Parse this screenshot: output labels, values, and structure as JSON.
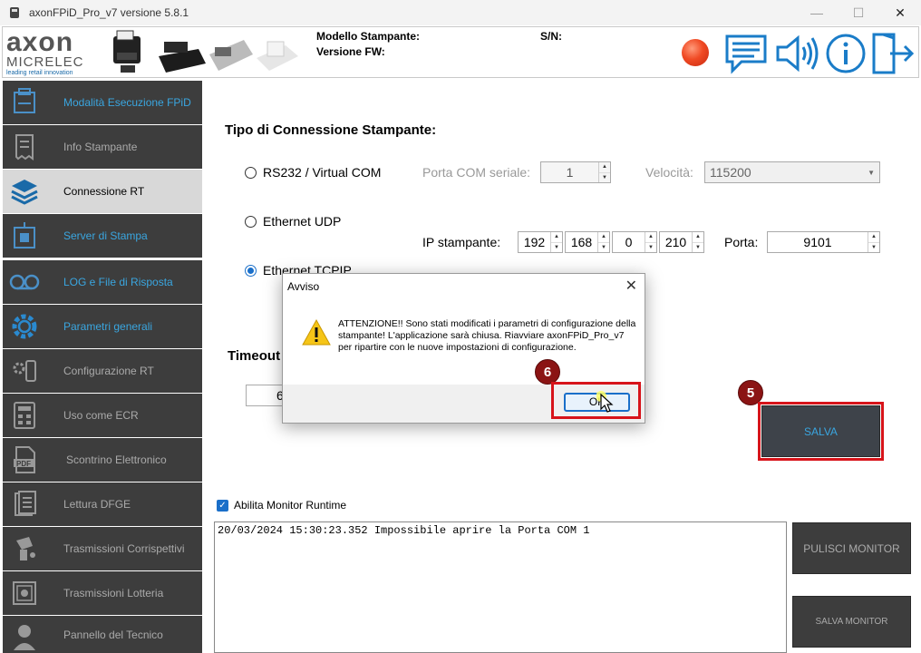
{
  "window": {
    "title": "axonFPiD_Pro_v7 versione 5.8.1",
    "min": "—",
    "max": "☐",
    "close": "✕"
  },
  "header": {
    "logo_main": "axon",
    "logo_sub": "MICRELEC",
    "logo_tag": "leading retail innovation",
    "model_label": "Modello Stampante:",
    "fw_label": "Versione FW:",
    "sn_label": "S/N:",
    "status_color": "#e8401c"
  },
  "sidebar": {
    "items": [
      {
        "label": "Modalità Esecuzione FPiD",
        "icon": "printer-server-icon",
        "highlight": true
      },
      {
        "label": "Info Stampante",
        "icon": "receipt-icon",
        "highlight": false
      },
      {
        "label": "Connessione RT",
        "icon": "layers-icon",
        "active": true
      },
      {
        "label": "Server di Stampa",
        "icon": "print-server-icon",
        "highlight": true
      },
      {
        "label": "LOG e File di Risposta",
        "icon": "tape-icon",
        "highlight": true
      },
      {
        "label": "Parametri generali",
        "icon": "gear-icon",
        "highlight": true
      },
      {
        "label": "Configurazione RT",
        "icon": "gear-device-icon",
        "highlight": false
      },
      {
        "label": "Uso come ECR",
        "icon": "calculator-icon",
        "highlight": false
      },
      {
        "label": "Scontrino Elettronico",
        "icon": "pdf-icon",
        "highlight": false
      },
      {
        "label": "Lettura DFGE",
        "icon": "documents-icon",
        "highlight": false
      },
      {
        "label": "Trasmissioni Corrispettivi",
        "icon": "transmit-icon",
        "highlight": false
      },
      {
        "label": "Trasmissioni Lotteria",
        "icon": "ticket-icon",
        "highlight": false
      },
      {
        "label": "Pannello del Tecnico",
        "icon": "user-icon",
        "highlight": false
      }
    ]
  },
  "connection": {
    "title": "Tipo di Connessione Stampante:",
    "opt_rs232": "RS232 / Virtual COM",
    "opt_udp": "Ethernet UDP",
    "opt_tcp": "Ethernet TCPIP",
    "com_label": "Porta COM seriale:",
    "com_value": "1",
    "speed_label": "Velocità:",
    "speed_value": "115200",
    "ip_label": "IP stampante:",
    "ip": [
      "192",
      "168",
      "0",
      "210"
    ],
    "port_label": "Porta:",
    "port_value": "9101",
    "timeout_label": "Timeout",
    "timeout_value": "6"
  },
  "buttons": {
    "salva": "SALVA",
    "pulisci": "PULISCI MONITOR",
    "salva_monitor": "SALVA MONITOR"
  },
  "badges": {
    "b5": "5",
    "b6": "6"
  },
  "monitor": {
    "checkbox_label": "Abilita Monitor Runtime",
    "log_line": "20/03/2024 15:30:23.352  Impossibile aprire la Porta COM 1"
  },
  "dialog": {
    "title": "Avviso",
    "message": "ATTENZIONE!! Sono stati modificati i parametri di configurazione della stampante! L'applicazione sarà chiusa. Riavviare axonFPiD_Pro_v7 per ripartire con le nuove impostazioni di configurazione.",
    "ok": "OK"
  },
  "colors": {
    "accent": "#3aa6e0",
    "sidebar_bg": "#3d3d3d",
    "highlight_red": "#d7141a",
    "badge": "#8b1414"
  }
}
